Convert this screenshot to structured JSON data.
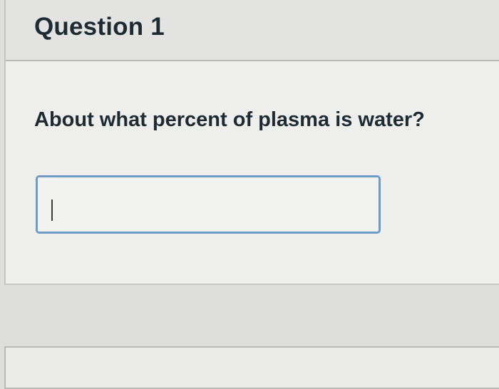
{
  "question": {
    "title": "Question 1",
    "text": "About what percent of plasma is water?",
    "answer": {
      "value": "",
      "placeholder": ""
    }
  }
}
